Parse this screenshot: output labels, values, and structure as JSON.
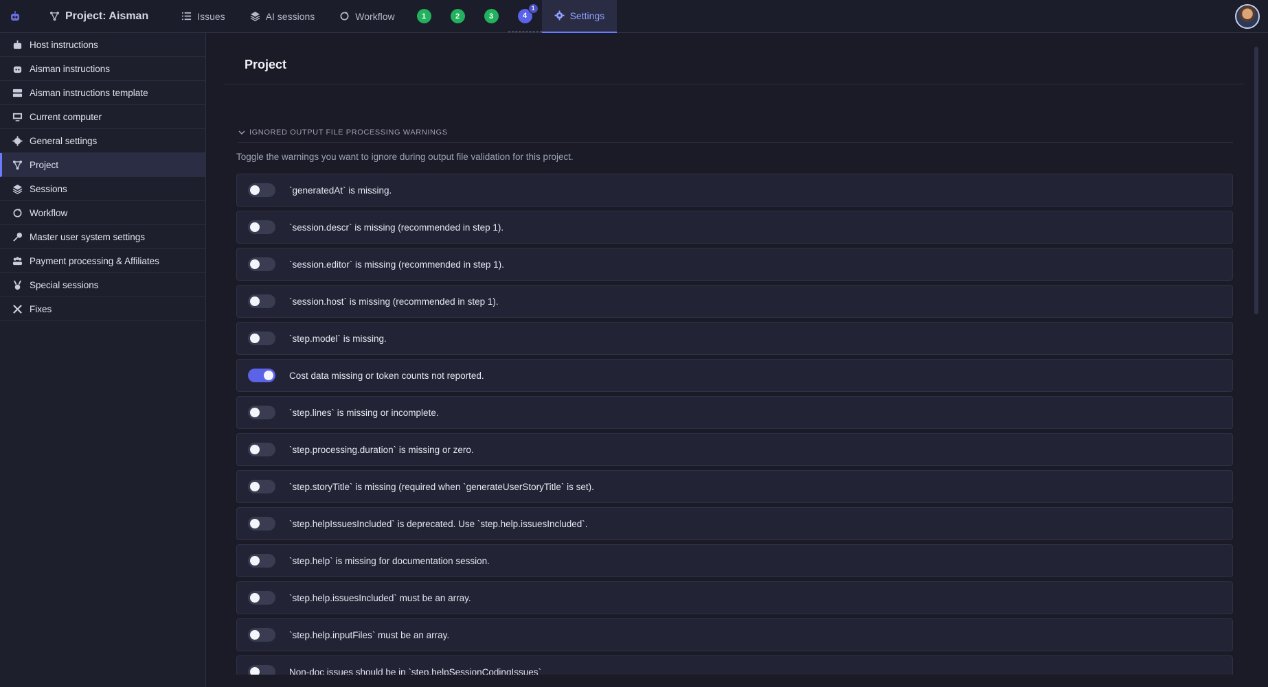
{
  "topbar": {
    "project_label": "Project: Aisman",
    "issues_label": "Issues",
    "ai_sessions_label": "AI sessions",
    "workflow_label": "Workflow",
    "steps": [
      "1",
      "2",
      "3",
      "4"
    ],
    "step4_badge": "1",
    "settings_label": "Settings"
  },
  "sidebar": {
    "items": [
      {
        "label": "Host instructions",
        "icon": "robot-icon"
      },
      {
        "label": "Aisman instructions",
        "icon": "robot-face-icon"
      },
      {
        "label": "Aisman instructions template",
        "icon": "template-icon"
      },
      {
        "label": "Current computer",
        "icon": "monitor-icon"
      },
      {
        "label": "General settings",
        "icon": "gear-icon"
      },
      {
        "label": "Project",
        "icon": "project-icon"
      },
      {
        "label": "Sessions",
        "icon": "layers-icon"
      },
      {
        "label": "Workflow",
        "icon": "workflow-icon"
      },
      {
        "label": "Master user system settings",
        "icon": "key-icon"
      },
      {
        "label": "Payment processing & Affiliates",
        "icon": "users-icon"
      },
      {
        "label": "Special sessions",
        "icon": "medal-icon"
      },
      {
        "label": "Fixes",
        "icon": "tools-icon"
      }
    ],
    "active_index": 5
  },
  "main": {
    "title": "Project",
    "section_title": "IGNORED OUTPUT FILE PROCESSING WARNINGS",
    "section_desc": "Toggle the warnings you want to ignore during output file validation for this project.",
    "warnings": [
      {
        "label": "`generatedAt` is missing.",
        "on": false
      },
      {
        "label": "`session.descr` is missing (recommended in step 1).",
        "on": false
      },
      {
        "label": "`session.editor` is missing (recommended in step 1).",
        "on": false
      },
      {
        "label": "`session.host` is missing (recommended in step 1).",
        "on": false
      },
      {
        "label": "`step.model` is missing.",
        "on": false
      },
      {
        "label": "Cost data missing or token counts not reported.",
        "on": true
      },
      {
        "label": "`step.lines` is missing or incomplete.",
        "on": false
      },
      {
        "label": "`step.processing.duration` is missing or zero.",
        "on": false
      },
      {
        "label": "`step.storyTitle` is missing (required when `generateUserStoryTitle` is set).",
        "on": false
      },
      {
        "label": "`step.helpIssuesIncluded` is deprecated. Use `step.help.issuesIncluded`.",
        "on": false
      },
      {
        "label": "`step.help` is missing for documentation session.",
        "on": false
      },
      {
        "label": "`step.help.issuesIncluded` must be an array.",
        "on": false
      },
      {
        "label": "`step.help.inputFiles` must be an array.",
        "on": false
      },
      {
        "label": "Non-doc issues should be in `step.helpSessionCodingIssues`",
        "on": false
      }
    ]
  },
  "colors": {
    "accent": "#5b63e8",
    "step_green": "#22b25e",
    "background": "#1a1b26"
  }
}
